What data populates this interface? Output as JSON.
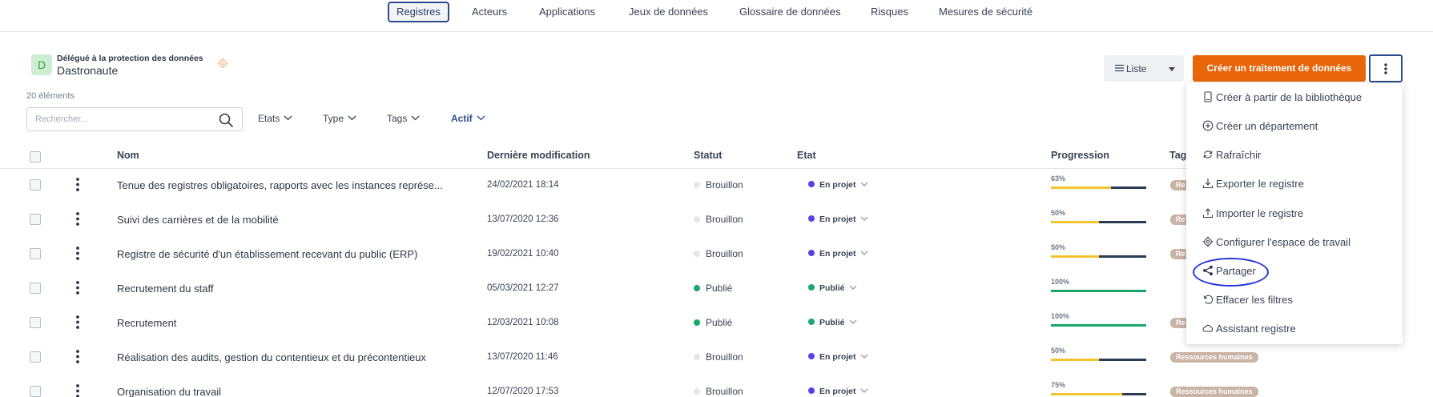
{
  "nav": {
    "tabs": [
      {
        "label": "Registres",
        "active": true
      },
      {
        "label": "Acteurs"
      },
      {
        "label": "Applications"
      },
      {
        "label": "Jeux de données"
      },
      {
        "label": "Glossaire de données"
      },
      {
        "label": "Risques"
      },
      {
        "label": "Mesures de sécurité"
      }
    ]
  },
  "delegate": {
    "initial": "D",
    "role": "Délégué à la protection des données",
    "name": "Dastronaute",
    "icon": "gear-icon"
  },
  "list": {
    "count": "20 éléments",
    "search_placeholder": "Rechercher...",
    "filters": [
      "Etats",
      "Type",
      "Tags",
      "Actif"
    ],
    "active_filter": "Actif"
  },
  "toolbar": {
    "view_label": "Liste",
    "create_label": "Créer un traitement de données"
  },
  "colors": {
    "accent": "#e8650a",
    "primary": "#2c4a8a",
    "draft": "#e3e6ea",
    "published": "#1aa76a",
    "project": "#5a3ee8",
    "progress_partial": "#f4c430",
    "progress_full": "#1aa76a",
    "tag": "#c9b4a6"
  },
  "table": {
    "headers": {
      "name": "Nom",
      "modified": "Dernière modification",
      "status": "Statut",
      "state": "Etat",
      "progress": "Progression",
      "tags": "Tag"
    },
    "rows": [
      {
        "name": "Tenue des registres obligatoires, rapports avec les instances représe...",
        "modified": "24/02/2021 18:14",
        "status": "Brouillon",
        "state": "En projet",
        "progress_label": "63%",
        "progress": 0.63,
        "tag": "Re"
      },
      {
        "name": "Suivi des carrières et de la mobilité",
        "modified": "13/07/2020 12:36",
        "status": "Brouillon",
        "state": "En projet",
        "progress_label": "50%",
        "progress": 0.5,
        "tag": "Re"
      },
      {
        "name": "Registre de sécurité d'un établissement recevant du public (ERP)",
        "modified": "19/02/2021 10:40",
        "status": "Brouillon",
        "state": "En projet",
        "progress_label": "50%",
        "progress": 0.5,
        "tag": "Re"
      },
      {
        "name": "Recrutement du staff",
        "modified": "05/03/2021 12:27",
        "status": "Publié",
        "state": "Publié",
        "progress_label": "100%",
        "progress": 1.0,
        "tag": ""
      },
      {
        "name": "Recrutement",
        "modified": "12/03/2021 10:08",
        "status": "Publié",
        "state": "Publié",
        "progress_label": "100%",
        "progress": 1.0,
        "tag": "Re"
      },
      {
        "name": "Réalisation des audits, gestion du contentieux et du précontentieux",
        "modified": "13/07/2020 11:46",
        "status": "Brouillon",
        "state": "En projet",
        "progress_label": "50%",
        "progress": 0.5,
        "tag": "Ressources humaines"
      },
      {
        "name": "Organisation du travail",
        "modified": "12/07/2020 17:53",
        "status": "Brouillon",
        "state": "En projet",
        "progress_label": "75%",
        "progress": 0.75,
        "tag": "Ressources humaines"
      }
    ]
  },
  "menu": {
    "items": [
      {
        "label": "Créer à partir de la bibliothèque",
        "icon": "book-icon"
      },
      {
        "label": "Créer un département",
        "icon": "plus-circle-icon"
      },
      {
        "label": "Rafraîchir",
        "icon": "refresh-icon"
      },
      {
        "label": "Exporter le registre",
        "icon": "download-icon"
      },
      {
        "label": "Importer le registre",
        "icon": "upload-icon"
      },
      {
        "label": "Configurer l'espace de travail",
        "icon": "gear-icon"
      },
      {
        "label": "Partager",
        "icon": "share-icon",
        "highlighted": true
      },
      {
        "label": "Effacer les filtres",
        "icon": "undo-icon"
      },
      {
        "label": "Assistant registre",
        "icon": "cloud-icon"
      }
    ]
  }
}
